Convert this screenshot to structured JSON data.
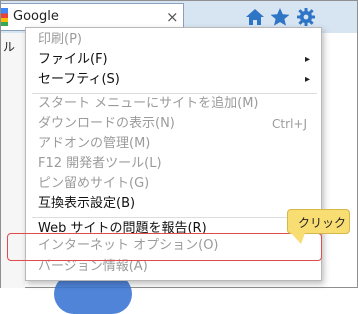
{
  "browser": {
    "tab_title": "Google",
    "close_symbol": "×",
    "page_partial_label": "ル",
    "toolbar_icons": [
      "home-icon",
      "favorites-star-icon",
      "settings-gear-icon"
    ],
    "accent_color": "#2f75c5"
  },
  "menu": {
    "items": [
      {
        "label": "印刷(P)",
        "enabled": false
      },
      {
        "label": "ファイル(F)",
        "enabled": true,
        "submenu": true
      },
      {
        "label": "セーフティ(S)",
        "enabled": true,
        "submenu": true
      },
      {
        "label": "スタート メニューにサイトを追加(M)",
        "enabled": false
      },
      {
        "label": "ダウンロードの表示(N)",
        "enabled": false,
        "shortcut": "Ctrl+J"
      },
      {
        "label": "アドオンの管理(M)",
        "enabled": false
      },
      {
        "label": "F12 開発者ツール(L)",
        "enabled": false
      },
      {
        "label": "ピン留めサイト(G)",
        "enabled": false
      },
      {
        "label": "互換表示設定(B)",
        "enabled": true
      },
      {
        "label": "Web サイトの問題を報告(R)",
        "enabled": true
      },
      {
        "label": "インターネット オプション(O)",
        "enabled": false
      },
      {
        "label": "バージョン情報(A)",
        "enabled": false
      }
    ],
    "submenu_arrow": "▸"
  },
  "annotation": {
    "callout_text": "クリック",
    "highlight_color": "#e04b4b",
    "callout_color": "#f7dd72"
  }
}
